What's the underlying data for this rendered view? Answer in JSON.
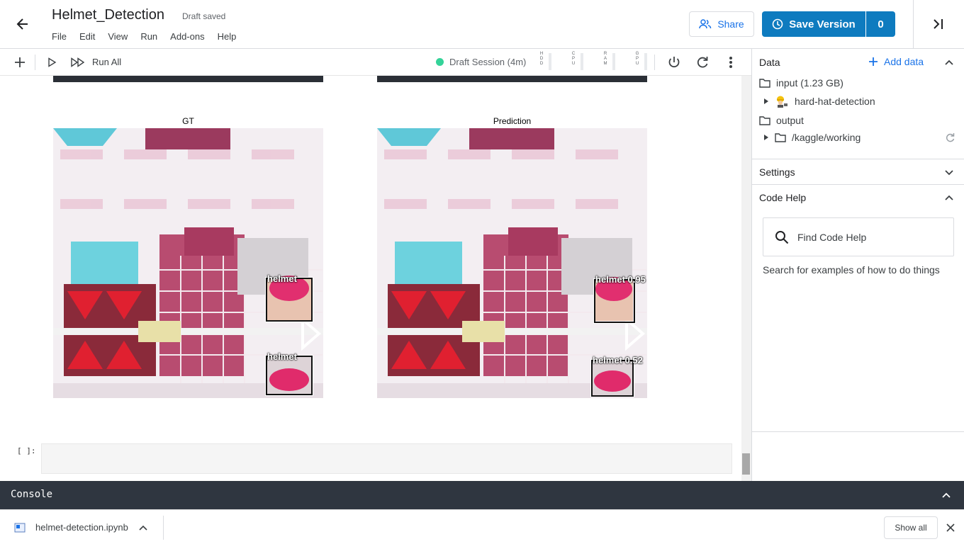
{
  "header": {
    "title": "Helmet_Detection",
    "status": "Draft saved",
    "menu": [
      "File",
      "Edit",
      "View",
      "Run",
      "Add-ons",
      "Help"
    ],
    "share_label": "Share",
    "save_version_label": "Save Version",
    "version_count": "0"
  },
  "toolbar": {
    "run_all_label": "Run All",
    "session_label": "Draft Session (4m)",
    "meters": [
      "HDD",
      "CPU",
      "RAM",
      "GPU"
    ]
  },
  "output": {
    "gt_title": "GT",
    "prediction_title": "Prediction",
    "gt_boxes": [
      {
        "label": "helmet"
      },
      {
        "label": "helmet"
      }
    ],
    "pred_boxes": [
      {
        "label": "helmet 0.95"
      },
      {
        "label": "helmet 0.52"
      }
    ],
    "cell_prompt": "[ ]:"
  },
  "panel": {
    "data_title": "Data",
    "add_data_label": "Add data",
    "input_label": "input (1.23 GB)",
    "dataset_name": "hard-hat-detection",
    "output_label": "output",
    "working_dir": "/kaggle/working",
    "settings_title": "Settings",
    "code_help_title": "Code Help",
    "search_placeholder": "Find Code Help",
    "code_help_hint": "Search for examples of how to do things"
  },
  "console": {
    "label": "Console"
  },
  "download_bar": {
    "filename": "helmet-detection.ipynb",
    "show_all_label": "Show all"
  },
  "colors": {
    "accent": "#0e7bbf",
    "link": "#1a73e8",
    "session_dot": "#34d399",
    "console_bg": "#2f3640"
  }
}
